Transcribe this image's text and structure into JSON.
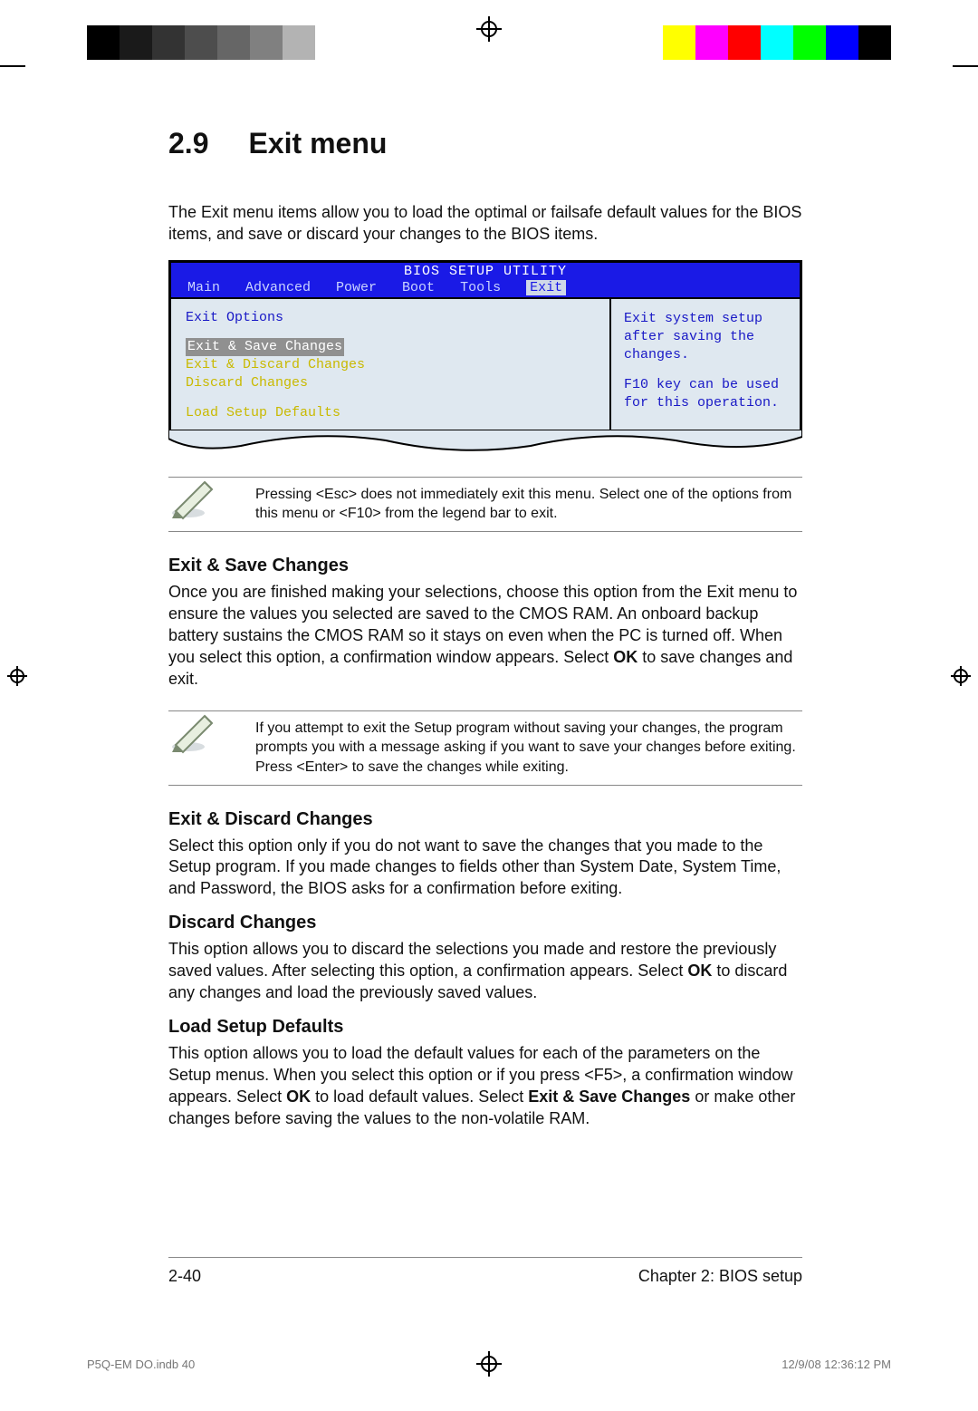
{
  "section": {
    "num": "2.9",
    "title": "Exit menu"
  },
  "intro": "The Exit menu items allow you to load the optimal or failsafe default values for the BIOS items, and save or discard your changes to the BIOS items.",
  "bios": {
    "utility_title": "BIOS SETUP UTILITY",
    "tabs": [
      "Main",
      "Advanced",
      "Power",
      "Boot",
      "Tools",
      "Exit"
    ],
    "active_tab_index": 5,
    "options_heading": "Exit Options",
    "options": [
      {
        "label": "Exit & Save Changes",
        "selected": true,
        "yellow": false
      },
      {
        "label": "Exit & Discard Changes",
        "selected": false,
        "yellow": true
      },
      {
        "label": "Discard Changes",
        "selected": false,
        "yellow": true
      },
      {
        "label": "Load Setup Defaults",
        "selected": false,
        "yellow": true
      }
    ],
    "help1": "Exit system setup after saving the changes.",
    "help2": "F10 key can be used for this operation."
  },
  "note1": "Pressing <Esc> does not immediately exit this menu. Select one of the options from this menu or <F10> from the legend bar to exit.",
  "sec1": {
    "heading": "Exit & Save Changes",
    "body_a": "Once you are finished making your selections, choose this option from the Exit menu to ensure the values you selected are saved to the CMOS RAM. An onboard backup battery sustains the CMOS RAM so it stays on even when the PC is turned off. When you select this option, a confirmation window appears. Select ",
    "body_ok": "OK",
    "body_b": " to save changes and exit."
  },
  "note2": "If you attempt to exit the Setup program without saving your changes, the program prompts you with a message asking if you want to save your changes before exiting. Press <Enter> to save the  changes while exiting.",
  "sec2": {
    "heading": "Exit & Discard Changes",
    "body": "Select this option only if you do not want to save the changes that you  made to the Setup program. If you made changes to fields other than System Date, System Time, and Password, the BIOS asks for a confirmation before exiting."
  },
  "sec3": {
    "heading": "Discard Changes",
    "body_a": "This option allows you to discard the selections you made and restore the previously saved values. After selecting this option, a confirmation appears. Select ",
    "body_ok": "OK",
    "body_b": " to discard any changes and load the previously saved values."
  },
  "sec4": {
    "heading": "Load Setup Defaults",
    "body_a": "This option allows you to load the default values for each of the parameters on the Setup menus. When you select this option or if you press <F5>, a confirmation window appears. Select ",
    "body_ok": "OK",
    "body_b": " to load default values. Select ",
    "body_bold": "Exit & Save Changes",
    "body_c": " or make other changes before saving the values to the non-volatile RAM."
  },
  "footer": {
    "page": "2-40",
    "chapter": "Chapter 2: BIOS setup"
  },
  "printfooter": {
    "file": "P5Q-EM DO.indb   40",
    "stamp": "12/9/08   12:36:12 PM"
  },
  "colors": {
    "grays": [
      "#000000",
      "#1a1a1a",
      "#333333",
      "#4d4d4d",
      "#666666",
      "#808080",
      "#b3b3b3",
      "#ffffff"
    ],
    "cbars": [
      "#ffffff",
      "#ffff00",
      "#ff00ff",
      "#ff0000",
      "#00ffff",
      "#00ff00",
      "#0000ff",
      "#000000"
    ]
  }
}
